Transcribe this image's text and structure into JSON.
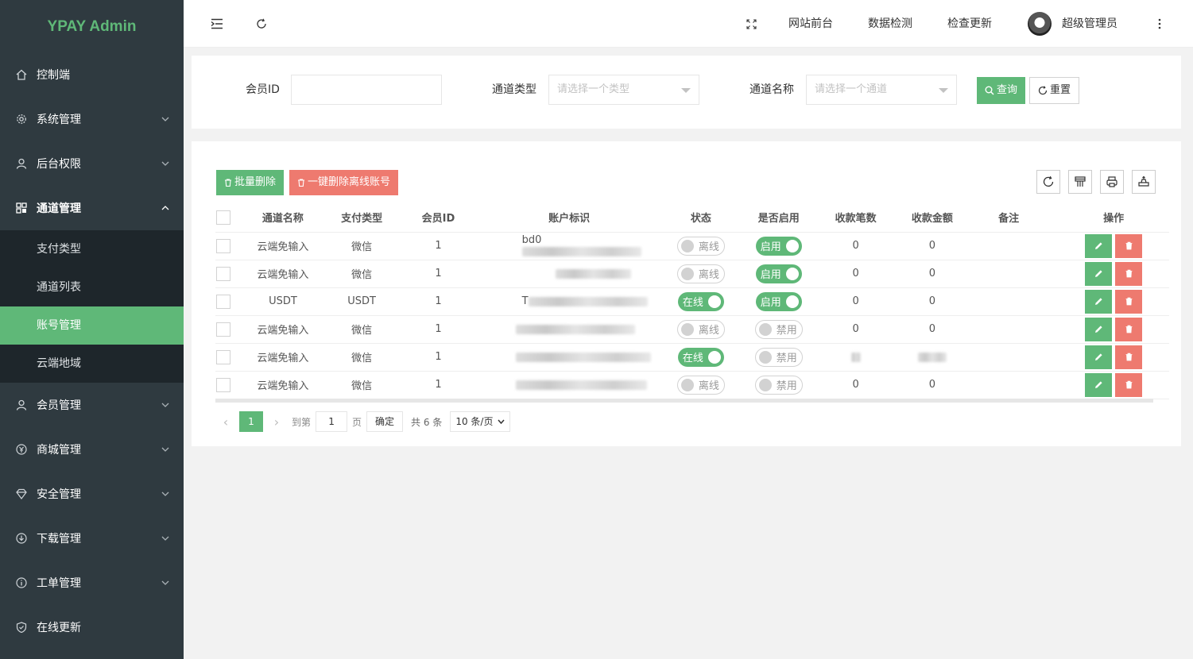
{
  "app": {
    "title": "YPAY Admin"
  },
  "sidebar": {
    "items": [
      {
        "label": "控制端",
        "icon": "home-icon"
      },
      {
        "label": "系统管理",
        "icon": "gear-icon"
      },
      {
        "label": "后台权限",
        "icon": "user-icon"
      },
      {
        "label": "通道管理",
        "icon": "grid-icon"
      },
      {
        "label": "会员管理",
        "icon": "user-icon"
      },
      {
        "label": "商城管理",
        "icon": "yen-icon"
      },
      {
        "label": "安全管理",
        "icon": "diamond-icon"
      },
      {
        "label": "下载管理",
        "icon": "download-icon"
      },
      {
        "label": "工单管理",
        "icon": "info-icon"
      },
      {
        "label": "在线更新",
        "icon": "shield-icon"
      }
    ],
    "subitems": [
      {
        "label": "支付类型"
      },
      {
        "label": "通道列表"
      },
      {
        "label": "账号管理"
      },
      {
        "label": "云端地域"
      }
    ]
  },
  "header": {
    "links": [
      "网站前台",
      "数据检测",
      "检查更新"
    ],
    "user": "超级管理员"
  },
  "search": {
    "member_label": "会员ID",
    "member_value": "",
    "type_label": "通道类型",
    "type_placeholder": "请选择一个类型",
    "name_label": "通道名称",
    "name_placeholder": "请选择一个通道",
    "query_btn": "查询",
    "reset_btn": "重置"
  },
  "toolbar": {
    "batch_delete": "批量删除",
    "delete_offline": "一键删除离线账号"
  },
  "table": {
    "headers": [
      "通道名称",
      "支付类型",
      "会员ID",
      "账户标识",
      "状态",
      "是否启用",
      "收款笔数",
      "收款金额",
      "备注",
      "操作"
    ],
    "rows": [
      {
        "channel": "云端免输入",
        "pay_type": "微信",
        "member": "1",
        "account": "bd0",
        "status": "离线",
        "enabled": "启用",
        "count": "0",
        "amount": "0"
      },
      {
        "channel": "云端免输入",
        "pay_type": "微信",
        "member": "1",
        "account": "",
        "status": "离线",
        "enabled": "启用",
        "count": "0",
        "amount": "0"
      },
      {
        "channel": "USDT",
        "pay_type": "USDT",
        "member": "1",
        "account": "T",
        "status": "在线",
        "enabled": "启用",
        "count": "0",
        "amount": "0"
      },
      {
        "channel": "云端免输入",
        "pay_type": "微信",
        "member": "1",
        "account": "",
        "status": "离线",
        "enabled": "禁用",
        "count": "0",
        "amount": "0"
      },
      {
        "channel": "云端免输入",
        "pay_type": "微信",
        "member": "1",
        "account": "",
        "status": "在线",
        "enabled": "禁用",
        "count": "",
        "amount": ""
      },
      {
        "channel": "云端免输入",
        "pay_type": "微信",
        "member": "1",
        "account": "",
        "status": "离线",
        "enabled": "禁用",
        "count": "0",
        "amount": "0"
      }
    ]
  },
  "pagination": {
    "current": "1",
    "goto_label": "到第",
    "goto_value": "1",
    "page_label": "页",
    "confirm": "确定",
    "total": "共 6 条",
    "per_page": "10 条/页"
  },
  "colors": {
    "accent": "#5fb878",
    "danger": "#ee7a6f",
    "sidebar": "#2f3a40"
  }
}
